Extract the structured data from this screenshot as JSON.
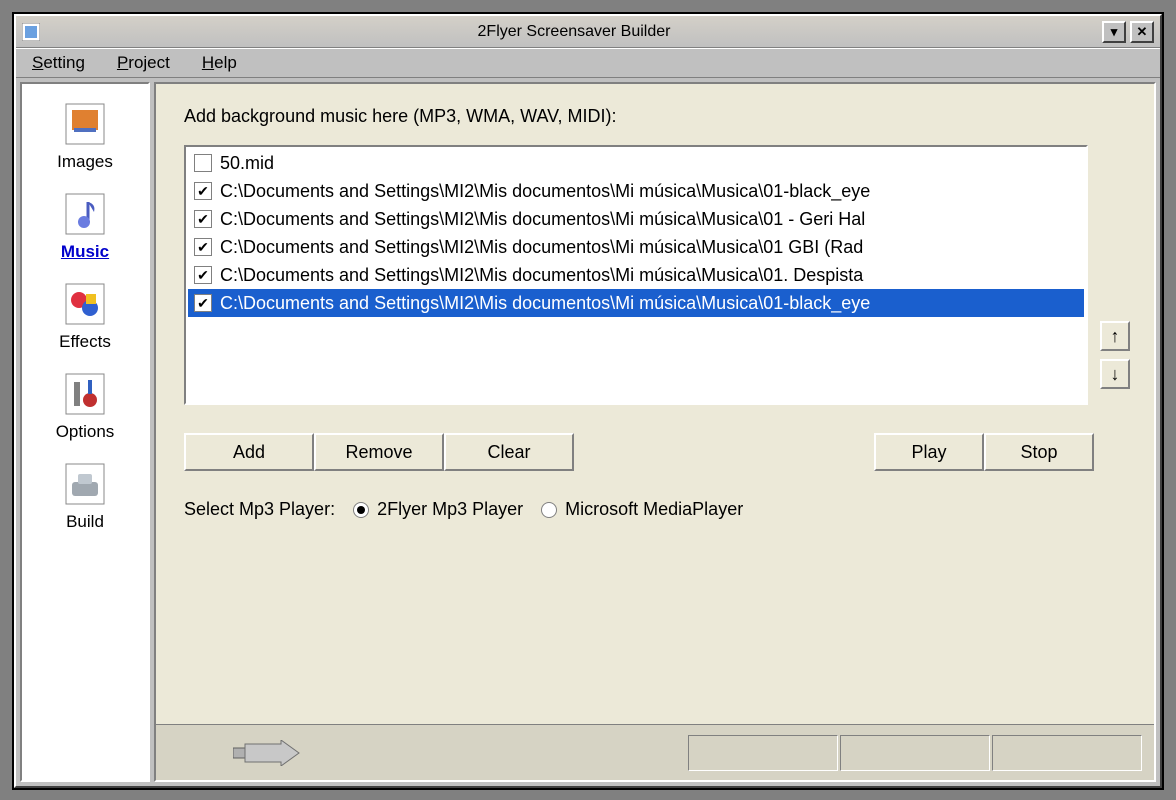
{
  "window": {
    "title": "2Flyer Screensaver Builder"
  },
  "menu": {
    "setting": "Setting",
    "project": "Project",
    "help": "Help"
  },
  "sidebar": {
    "items": [
      {
        "label": "Images"
      },
      {
        "label": "Music"
      },
      {
        "label": "Effects"
      },
      {
        "label": "Options"
      },
      {
        "label": "Build"
      }
    ]
  },
  "main": {
    "section_label": "Add background music here (MP3, WMA, WAV, MIDI):",
    "files": [
      {
        "checked": false,
        "name": "50.mid"
      },
      {
        "checked": true,
        "name": "C:\\Documents and Settings\\MI2\\Mis documentos\\Mi música\\Musica\\01-black_eye"
      },
      {
        "checked": true,
        "name": "C:\\Documents and Settings\\MI2\\Mis documentos\\Mi música\\Musica\\01 - Geri Hal"
      },
      {
        "checked": true,
        "name": "C:\\Documents and Settings\\MI2\\Mis documentos\\Mi música\\Musica\\01 GBI (Rad"
      },
      {
        "checked": true,
        "name": "C:\\Documents and Settings\\MI2\\Mis documentos\\Mi música\\Musica\\01. Despista"
      },
      {
        "checked": true,
        "name": "C:\\Documents and Settings\\MI2\\Mis documentos\\Mi música\\Musica\\01-black_eye"
      }
    ],
    "buttons": {
      "add": "Add",
      "remove": "Remove",
      "clear": "Clear",
      "play": "Play",
      "stop": "Stop"
    },
    "player": {
      "label": "Select Mp3 Player:",
      "opt1": "2Flyer Mp3 Player",
      "opt2": "Microsoft MediaPlayer"
    }
  }
}
